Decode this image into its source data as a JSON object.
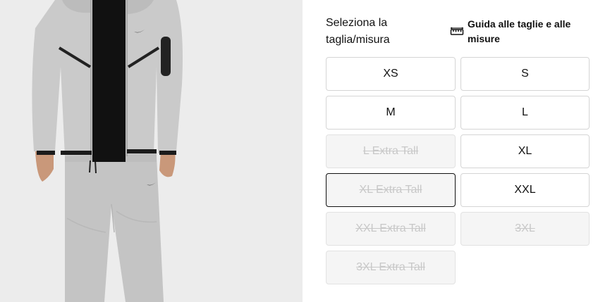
{
  "header": {
    "title": "Seleziona la taglia/misura",
    "guide_label": "Guida alle taglie e alle misure",
    "guide_icon": "ruler-icon"
  },
  "sizes": [
    {
      "label": "XS",
      "available": true,
      "selected": false
    },
    {
      "label": "S",
      "available": true,
      "selected": false
    },
    {
      "label": "M",
      "available": true,
      "selected": false
    },
    {
      "label": "L",
      "available": true,
      "selected": false
    },
    {
      "label": "L Extra Tall",
      "available": false,
      "selected": false
    },
    {
      "label": "XL",
      "available": true,
      "selected": false
    },
    {
      "label": "XL Extra Tall",
      "available": false,
      "selected": true
    },
    {
      "label": "XXL",
      "available": true,
      "selected": false
    },
    {
      "label": "XXL Extra Tall",
      "available": false,
      "selected": false
    },
    {
      "label": "3XL",
      "available": false,
      "selected": false
    },
    {
      "label": "3XL Extra Tall",
      "available": false,
      "selected": false
    }
  ],
  "colors": {
    "text": "#111111",
    "border": "#d5d5d5",
    "disabled_bg": "#f5f5f5",
    "disabled_text": "#c8c8c8",
    "image_bg": "#ececec",
    "garment": "#c9c9c9"
  }
}
